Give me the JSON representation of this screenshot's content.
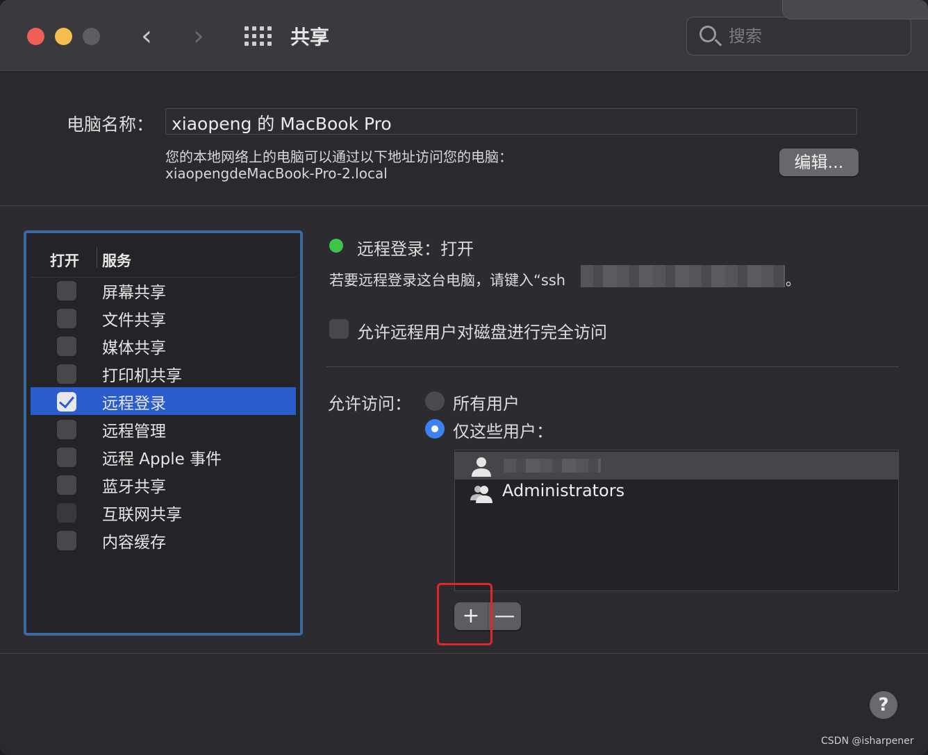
{
  "window": {
    "title": "共享",
    "search_placeholder": "搜索"
  },
  "computer_name": {
    "label": "电脑名称：",
    "value": "xiaopeng 的 MacBook Pro",
    "hint_line1": "您的本地网络上的电脑可以通过以下地址访问您的电脑：",
    "hint_line2": "xiaopengdeMacBook-Pro-2.local",
    "edit_label": "编辑..."
  },
  "services": {
    "col_on": "打开",
    "col_service": "服务",
    "items": [
      {
        "label": "屏幕共享",
        "checked": false
      },
      {
        "label": "文件共享",
        "checked": false
      },
      {
        "label": "媒体共享",
        "checked": false
      },
      {
        "label": "打印机共享",
        "checked": false
      },
      {
        "label": "远程登录",
        "checked": true
      },
      {
        "label": "远程管理",
        "checked": false
      },
      {
        "label": "远程 Apple 事件",
        "checked": false
      },
      {
        "label": "蓝牙共享",
        "checked": false
      },
      {
        "label": "互联网共享",
        "checked": false
      },
      {
        "label": "内容缓存",
        "checked": false
      }
    ]
  },
  "detail": {
    "status": "远程登录：打开",
    "instruction_prefix": "若要远程登录这台电脑，请键入“ssh",
    "instruction_suffix": "。",
    "full_disk_label": "允许远程用户对磁盘进行完全访问",
    "allow_access_label": "允许访问：",
    "option_all": "所有用户",
    "option_only": "仅这些用户：",
    "users": [
      "Administrators"
    ],
    "add_label": "+",
    "remove_label": "—"
  },
  "footer": {
    "help_label": "?",
    "watermark": "CSDN @isharpener"
  },
  "colors": {
    "accent": "#2b5ccd",
    "status_green": "#3fc44a",
    "highlight_frame": "#e3262a"
  }
}
